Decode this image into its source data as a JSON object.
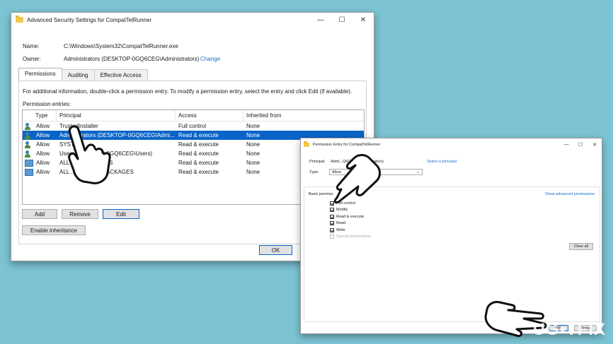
{
  "main_window": {
    "title": "Advanced Security Settings for CompatTelRunner",
    "name_label": "Name:",
    "name_value": "C:\\Windows\\System32\\CompatTelRunner.exe",
    "owner_label": "Owner:",
    "owner_value": "Administrators (DESKTOP-0GQ6CEG\\Administrators)",
    "change_link": "Change",
    "tabs": [
      "Permissions",
      "Auditing",
      "Effective Access"
    ],
    "info_text": "For additional information, double-click a permission entry. To modify a permission entry, select the entry and click Edit (if available).",
    "entries_label": "Permission entries:",
    "columns": [
      "Type",
      "Principal",
      "Access",
      "Inherited from"
    ],
    "rows": [
      {
        "type": "Allow",
        "principal": "TrustedInstaller",
        "access": "Full control",
        "inherited": "None",
        "icon": "user-icon"
      },
      {
        "type": "Allow",
        "principal": "Administrators (DESKTOP-0GQ6CEG\\Admi...",
        "access": "Read & execute",
        "inherited": "None",
        "icon": "user-icon"
      },
      {
        "type": "Allow",
        "principal": "SYST",
        "access": "Read & execute",
        "inherited": "None",
        "icon": "user-icon"
      },
      {
        "type": "Allow",
        "principal": "Users (DESKTOP-0GQ6CEG\\Users)",
        "access": "Read & execute",
        "inherited": "None",
        "icon": "user-icon"
      },
      {
        "type": "Allow",
        "principal": "ALL AP...PACKAGES",
        "access": "Read & execute",
        "inherited": "None",
        "icon": "package-icon"
      },
      {
        "type": "Allow",
        "principal": "ALL ...LICATION PACKAGES",
        "access": "Read & execute",
        "inherited": "None",
        "icon": "package-icon"
      }
    ],
    "add_button": "Add",
    "remove_button": "Remove",
    "edit_button": "Edit",
    "inherit_button": "Enable inheritance",
    "ok_button": "OK"
  },
  "entry_window": {
    "title": "Permission Entry for CompatTelRunner",
    "principal_label": "Principal:",
    "principal_value": "Admi...Q6CEG\\Administrators)",
    "select_principal_link": "Select a principal",
    "type_label": "Type:",
    "type_value": "Allow",
    "basic_permissions_label": "Basic permiss",
    "show_advanced_link": "Show advanced permissions",
    "permissions": [
      {
        "label": "Full control",
        "checked": true,
        "disabled": false
      },
      {
        "label": "Modify",
        "checked": true,
        "disabled": false
      },
      {
        "label": "Read & execute",
        "checked": true,
        "disabled": false
      },
      {
        "label": "Read",
        "checked": true,
        "disabled": false
      },
      {
        "label": "Write",
        "checked": true,
        "disabled": false
      },
      {
        "label": "Special permissions",
        "checked": false,
        "disabled": true
      }
    ],
    "clear_all_button": "Clear all",
    "ok_button": "OK",
    "cancel_button": "Cancel"
  },
  "watermark": "UG•TFIX",
  "colors": {
    "background": "#7cc4d4",
    "selection": "#0a64c8",
    "link": "#1a6fc4"
  }
}
